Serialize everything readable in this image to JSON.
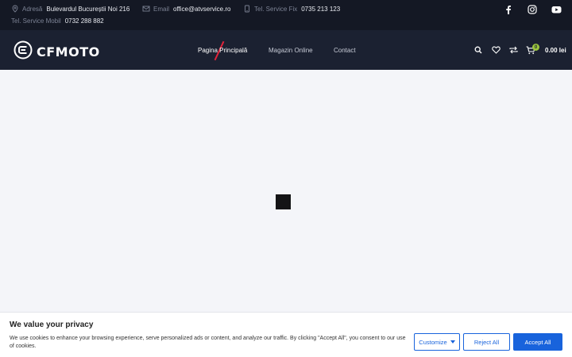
{
  "topbar": {
    "address": {
      "label": "Adresă",
      "value": "Bulevardul Bucureștii Noi 216",
      "icon": "map-pin-icon"
    },
    "email": {
      "label": "Email",
      "value": "office@atvservice.ro",
      "icon": "mail-icon"
    },
    "phone_fix": {
      "label": "Tel. Service Fix",
      "value": "0735 213 123",
      "icon": "phone-icon"
    },
    "phone_mobile": {
      "label": "Tel. Service Mobil",
      "value": "0732 288 882"
    },
    "social": [
      "facebook-icon",
      "instagram-icon",
      "youtube-icon"
    ]
  },
  "header": {
    "logo_text": "CFMOTO",
    "nav": [
      {
        "label": "Pagina Principală",
        "active": true
      },
      {
        "label": "Magazin Online",
        "active": false
      },
      {
        "label": "Contact",
        "active": false
      }
    ],
    "cart_count": "0",
    "cart_total": "0.00 lei"
  },
  "cookie": {
    "title": "We value your privacy",
    "text": "We use cookies to enhance your browsing experience, serve personalized ads or content, and analyze our traffic. By clicking \"Accept All\", you consent to our use of cookies.",
    "customize_label": "Customize",
    "reject_label": "Reject All",
    "accept_label": "Accept All"
  },
  "colors": {
    "topbar_bg": "#141824",
    "header_bg": "#1b2131",
    "accent_red": "#e0233a",
    "badge_green": "#9bc53d",
    "button_blue": "#1863dc"
  }
}
